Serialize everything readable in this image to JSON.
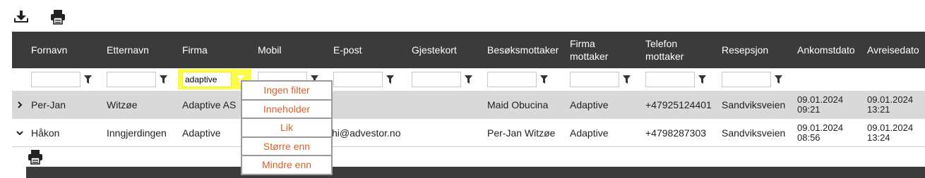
{
  "toolbar": {
    "download_icon": "download-icon",
    "print_icon": "print-icon"
  },
  "columns": [
    {
      "label": "Fornavn"
    },
    {
      "label": "Etternavn"
    },
    {
      "label": "Firma"
    },
    {
      "label": "Mobil"
    },
    {
      "label": "E-post"
    },
    {
      "label": "Gjestekort"
    },
    {
      "label": "Besøksmottaker"
    },
    {
      "label": "Firma mottaker"
    },
    {
      "label": "Telefon mottaker"
    },
    {
      "label": "Resepsjon"
    },
    {
      "label": "Ankomstdato"
    },
    {
      "label": "Avreisedato"
    }
  ],
  "filters": {
    "firma_value": "adaptive"
  },
  "rows": [
    {
      "expanded": false,
      "fornavn": "Per-Jan",
      "etternavn": "Witzøe",
      "firma": "Adaptive AS",
      "mobil": "",
      "epost": "",
      "gjestekort": "",
      "besoksmottaker": "Maid Obucina",
      "firma_mottaker": "Adaptive",
      "telefon_mottaker": "+47925124401",
      "resepsjon": "Sandviksveien",
      "ankomst_date": "09.01.2024",
      "ankomst_time": "09:21",
      "avreise_date": "09.01.2024",
      "avreise_time": "13:21"
    },
    {
      "expanded": true,
      "fornavn": "Håkon",
      "etternavn": "Inngjerdingen",
      "firma": "Adaptive",
      "mobil": "",
      "epost": "hi@advestor.no",
      "gjestekort": "",
      "besoksmottaker": "Per-Jan Witzøe",
      "firma_mottaker": "Adaptive",
      "telefon_mottaker": "+4798287303",
      "resepsjon": "Sandviksveien",
      "ankomst_date": "09.01.2024",
      "ankomst_time": "08:56",
      "avreise_date": "09.01.2024",
      "avreise_time": "13:24"
    }
  ],
  "filter_menu": {
    "items": [
      "Ingen filter",
      "Inneholder",
      "Lik",
      "Større enn",
      "Mindre enn"
    ],
    "color": "#d4602a"
  },
  "colors": {
    "header_bg": "#3b3b3b",
    "filter_highlight": "#fbfb4a",
    "row_alt": "#e5e5e5"
  }
}
